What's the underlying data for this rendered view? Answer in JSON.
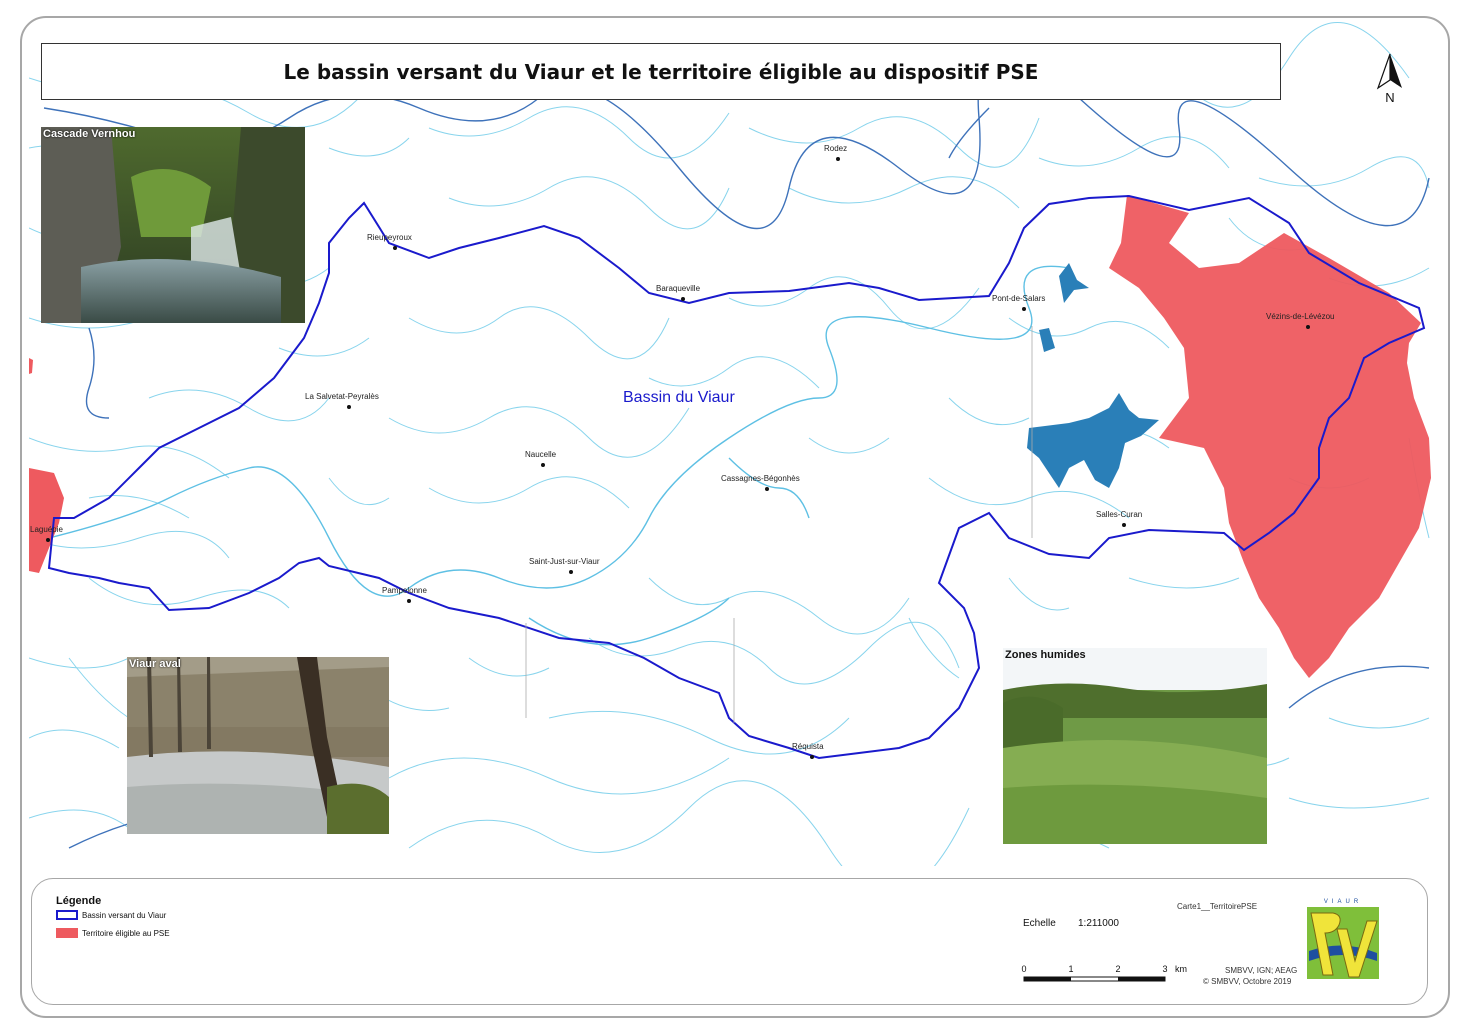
{
  "title": "Le bassin versant du Viaur et le territoire éligible au dispositif PSE",
  "north_label": "N",
  "region_label": "Bassin du Viaur",
  "towns": [
    {
      "name": "Rodez"
    },
    {
      "name": "Rieupeyroux"
    },
    {
      "name": "Baraqueville"
    },
    {
      "name": "Pont-de-Salars"
    },
    {
      "name": "Vézins-de-Lévézou"
    },
    {
      "name": "La Salvetat-Peyralès"
    },
    {
      "name": "Naucelle"
    },
    {
      "name": "Cassagnes-Bégonhès"
    },
    {
      "name": "Laguépie"
    },
    {
      "name": "Salles-Curan"
    },
    {
      "name": "Saint-Just-sur-Viaur"
    },
    {
      "name": "Pampelonne"
    },
    {
      "name": "Réquista"
    }
  ],
  "photos": {
    "cascade": "Cascade Vernhou",
    "aval": "Viaur aval",
    "zones": "Zones humides"
  },
  "legend": {
    "title": "Légende",
    "items": [
      {
        "label": "Bassin versant du Viaur",
        "color": "#1a1acc",
        "kind": "outline"
      },
      {
        "label": "Territoire éligible au PSE",
        "color": "#ee5a5f",
        "kind": "fill"
      }
    ]
  },
  "map_id": "Carte1__TerritoirePSE",
  "scale": {
    "label": "Echelle",
    "ratio": "1:211000",
    "ticks": [
      "0",
      "1",
      "2",
      "3"
    ],
    "unit": "km"
  },
  "credits": {
    "line1": "SMBVV, IGN; AEAG",
    "line2": "© SMBVV, Octobre 2019"
  },
  "logo_text": "VIAUR",
  "colors": {
    "basin_outline": "#1a1acc",
    "pse_territory": "#ee5a5f",
    "rivers": "#7fd0ea",
    "main_rivers": "#3c6fb8",
    "lake": "#2a7fb8"
  }
}
